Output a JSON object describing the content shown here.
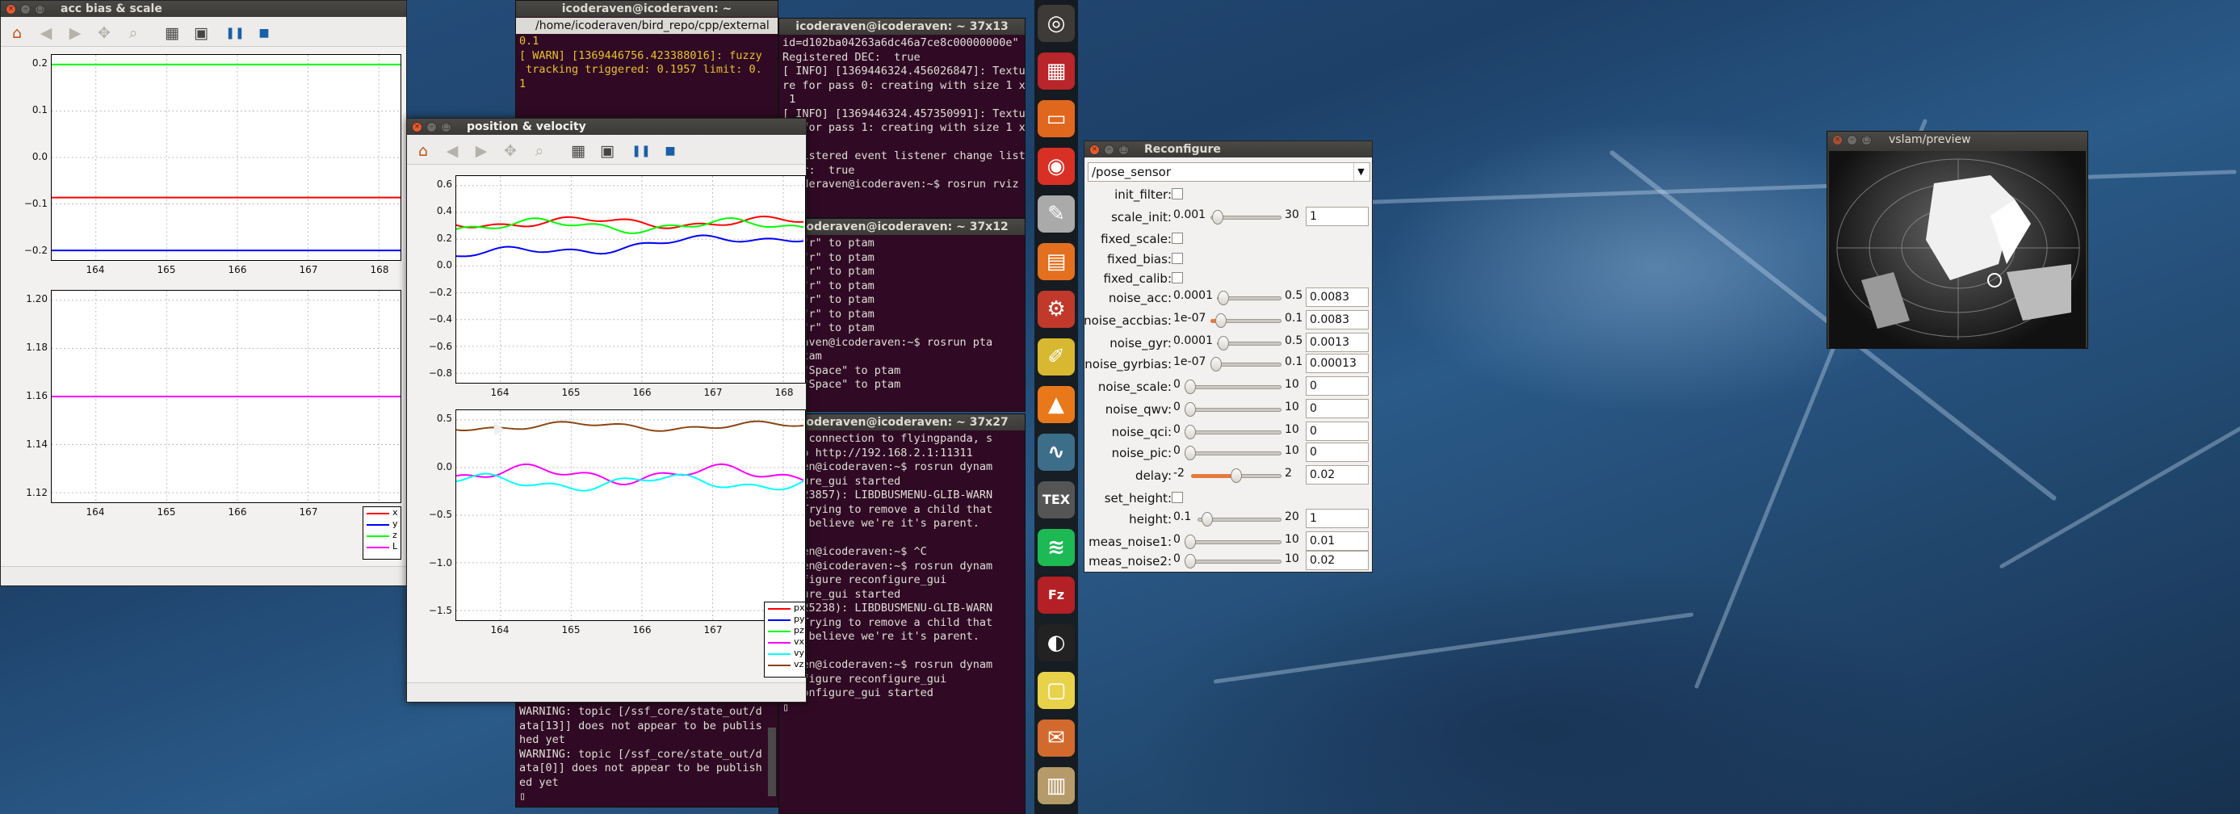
{
  "desktop": {
    "name": "ubuntu-unity-desktop"
  },
  "accbias": {
    "title": "acc bias & scale",
    "top_plot": {
      "yticks": [
        "0.2",
        "0.1",
        "0.0",
        "−0.1",
        "−0.2"
      ],
      "xticks": [
        "164",
        "165",
        "166",
        "167",
        "168"
      ]
    },
    "bottom_plot": {
      "yticks": [
        "1.20",
        "1.18",
        "1.16",
        "1.14",
        "1.12"
      ],
      "xticks": [
        "164",
        "165",
        "166",
        "167",
        "168"
      ]
    },
    "legend": [
      {
        "label": "x",
        "color": "#ff0000"
      },
      {
        "label": "y",
        "color": "#0000ff"
      },
      {
        "label": "z",
        "color": "#00ff00"
      },
      {
        "label": "L",
        "color": "#ff00ff"
      }
    ]
  },
  "posvel": {
    "title": "position & velocity",
    "top_plot": {
      "yticks": [
        "0.6",
        "0.4",
        "0.2",
        "0.0",
        "−0.2",
        "−0.4",
        "−0.6",
        "−0.8"
      ],
      "xticks": [
        "164",
        "165",
        "166",
        "167",
        "168"
      ]
    },
    "bottom_plot": {
      "yticks": [
        "0.5",
        "0.0",
        "−0.5",
        "−1.0",
        "−1.5"
      ],
      "xticks": [
        "164",
        "165",
        "166",
        "167",
        "168"
      ]
    },
    "legend": [
      {
        "label": "px",
        "color": "#ff0000"
      },
      {
        "label": "py",
        "color": "#0000ff"
      },
      {
        "label": "pz",
        "color": "#00ff00"
      },
      {
        "label": "vx",
        "color": "#ff00ff"
      },
      {
        "label": "vy",
        "color": "#00ffff"
      },
      {
        "label": "vz",
        "color": "#8b4513"
      }
    ]
  },
  "term_main": {
    "title": "icoderaven@icoderaven: ~",
    "tab": "/home/icoderaven/bird_repo/cpp/external",
    "lines": [
      "0.1",
      "",
      "[ WARN] [1369446756.423388016]: fuzzy",
      " tracking triggered: 0.1957 limit: 0.",
      "1"
    ],
    "bottom_lines": [
      "WARNING: topic [/ssf_core/state_out/d",
      "ata[13]] does not appear to be publis",
      "hed yet",
      "WARNING: topic [/ssf_core/state_out/d",
      "ata[0]] does not appear to be publish",
      "ed yet",
      "▯"
    ]
  },
  "term_a": {
    "title": "icoderaven@icoderaven: ~ 37x13",
    "lines": [
      "id=d102ba04263a6dc46a7ce8c00000000e\"",
      "Registered DEC:  true",
      "[ INFO] [1369446324.456026847]: Textu",
      "re for pass 0: creating with size 1 x",
      " 1",
      "[ INFO] [1369446324.457350991]: Textu",
      "re for pass 1: creating with size 1 x",
      " 1",
      "Registered event listener change list",
      "ener:  true",
      "icoderaven@icoderaven:~$ rosrun rviz"
    ]
  },
  "term_b": {
    "title": "icoderaven@icoderaven: ~ 37x12",
    "lines": [
      "ng \"r\" to ptam",
      "ng \"r\" to ptam",
      "ng \"r\" to ptam",
      "ng \"r\" to ptam",
      "ng \"r\" to ptam",
      "ng \"r\" to ptam",
      "ng \"r\" to ptam",
      "deraven@icoderaven:~$ rosrun pta",
      "e_ptam",
      "ng \"Space\" to ptam",
      "ng \"Space\" to ptam"
    ]
  },
  "term_c": {
    "title": "icoderaven@icoderaven: ~ 37x27",
    "lines": [
      "ted connection to flyingpanda, s",
      "r to http://192.168.2.1:11311",
      "raven@icoderaven:~$ rosrun dynam",
      "figure_gui started",
      "",
      "on:23857): LIBDBUSMENU-GLIB-WARN",
      "*: Trying to remove a child that",
      "n't believe we're it's parent.",
      "ng",
      "raven@icoderaven:~$ ^C",
      "raven@icoderaven:~$ rosrun dynam",
      "configure reconfigure_gui",
      "figure_gui started",
      "",
      "on:25238): LIBDBUSMENU-GLIB-WARN",
      "*: Trying to remove a child that",
      "n't believe we're it's parent.",
      "ng",
      "raven@icoderaven:~$ rosrun dynam",
      "configure reconfigure_gui",
      "reconfigure_gui started",
      "▯"
    ]
  },
  "reconfigure": {
    "title": "Reconfigure",
    "node": "/pose_sensor",
    "rows": [
      {
        "label": "init_filter:",
        "type": "check"
      },
      {
        "label": "scale_init:",
        "type": "slider",
        "min": "0.001",
        "max": "30",
        "value": "1",
        "pos": 0.03
      },
      {
        "label": "fixed_scale:",
        "type": "check"
      },
      {
        "label": "fixed_bias:",
        "type": "check"
      },
      {
        "label": "fixed_calib:",
        "type": "check"
      },
      {
        "label": "noise_acc:",
        "type": "slider",
        "min": "0.0001",
        "max": "0.5",
        "value": "0.0083",
        "pos": 0.02
      },
      {
        "label": "noise_accbias:",
        "type": "slider",
        "min": "1e-07",
        "max": "0.1",
        "value": "0.0083",
        "pos": 0.08,
        "fill": true
      },
      {
        "label": "noise_gyr:",
        "type": "slider",
        "min": "0.0001",
        "max": "0.5",
        "value": "0.0013",
        "pos": 0.01
      },
      {
        "label": "noise_gyrbias:",
        "type": "slider",
        "min": "1e-07",
        "max": "0.1",
        "value": "0.00013",
        "pos": 0.0
      },
      {
        "label": "noise_scale:",
        "type": "slider",
        "min": "0",
        "max": "10",
        "value": "0",
        "pos": 0.0
      },
      {
        "label": "noise_qwv:",
        "type": "slider",
        "min": "0",
        "max": "10",
        "value": "0",
        "pos": 0.0
      },
      {
        "label": "noise_qci:",
        "type": "slider",
        "min": "0",
        "max": "10",
        "value": "0",
        "pos": 0.0
      },
      {
        "label": "noise_pic:",
        "type": "slider",
        "min": "0",
        "max": "10",
        "value": "0",
        "pos": 0.0
      },
      {
        "label": "delay:",
        "type": "slider",
        "min": "-2",
        "max": "2",
        "value": "0.02",
        "pos": 0.5,
        "fill": true
      },
      {
        "label": "set_height:",
        "type": "check"
      },
      {
        "label": "height:",
        "type": "slider",
        "min": "0.1",
        "max": "20",
        "value": "1",
        "pos": 0.05
      },
      {
        "label": "meas_noise1:",
        "type": "slider",
        "min": "0",
        "max": "10",
        "value": "0.01",
        "pos": 0.0
      },
      {
        "label": "meas_noise2:",
        "type": "slider",
        "min": "0",
        "max": "10",
        "value": "0.02",
        "pos": 0.0
      }
    ]
  },
  "vslam": {
    "title": "vslam/preview"
  },
  "launcher": [
    {
      "name": "ubuntu-dash-icon",
      "glyph": "◎",
      "color": "#3d3a37"
    },
    {
      "name": "workspace-icon",
      "glyph": "▦",
      "color": "#b8252a"
    },
    {
      "name": "files-icon",
      "glyph": "▭",
      "color": "#e0671e"
    },
    {
      "name": "chrome-icon",
      "glyph": "◉",
      "color": "#d93025"
    },
    {
      "name": "text-editor-icon",
      "glyph": "✎",
      "color": "#aaa"
    },
    {
      "name": "archive-icon",
      "glyph": "▤",
      "color": "#e2701f"
    },
    {
      "name": "settings-icon",
      "glyph": "⚙",
      "color": "#c0392b"
    },
    {
      "name": "notes-editor-icon",
      "glyph": "✐",
      "color": "#d7b830"
    },
    {
      "name": "vlc-icon",
      "glyph": "▲",
      "color": "#e8781a"
    },
    {
      "name": "system-monitor-icon",
      "glyph": "∿",
      "color": "#3c6e8a"
    },
    {
      "name": "tex-icon",
      "glyph": "TEX",
      "color": "#555"
    },
    {
      "name": "spotify-icon",
      "glyph": "≋",
      "color": "#1db954"
    },
    {
      "name": "filezilla-icon",
      "glyph": "Fz",
      "color": "#b32025"
    },
    {
      "name": "steam-icon",
      "glyph": "◐",
      "color": "#222"
    },
    {
      "name": "sticky-notes-icon",
      "glyph": "▢",
      "color": "#e8d24a"
    },
    {
      "name": "software-center-icon",
      "glyph": "✉",
      "color": "#d26a2e"
    },
    {
      "name": "trash-icon",
      "glyph": "▥",
      "color": "#b59a6a"
    }
  ]
}
